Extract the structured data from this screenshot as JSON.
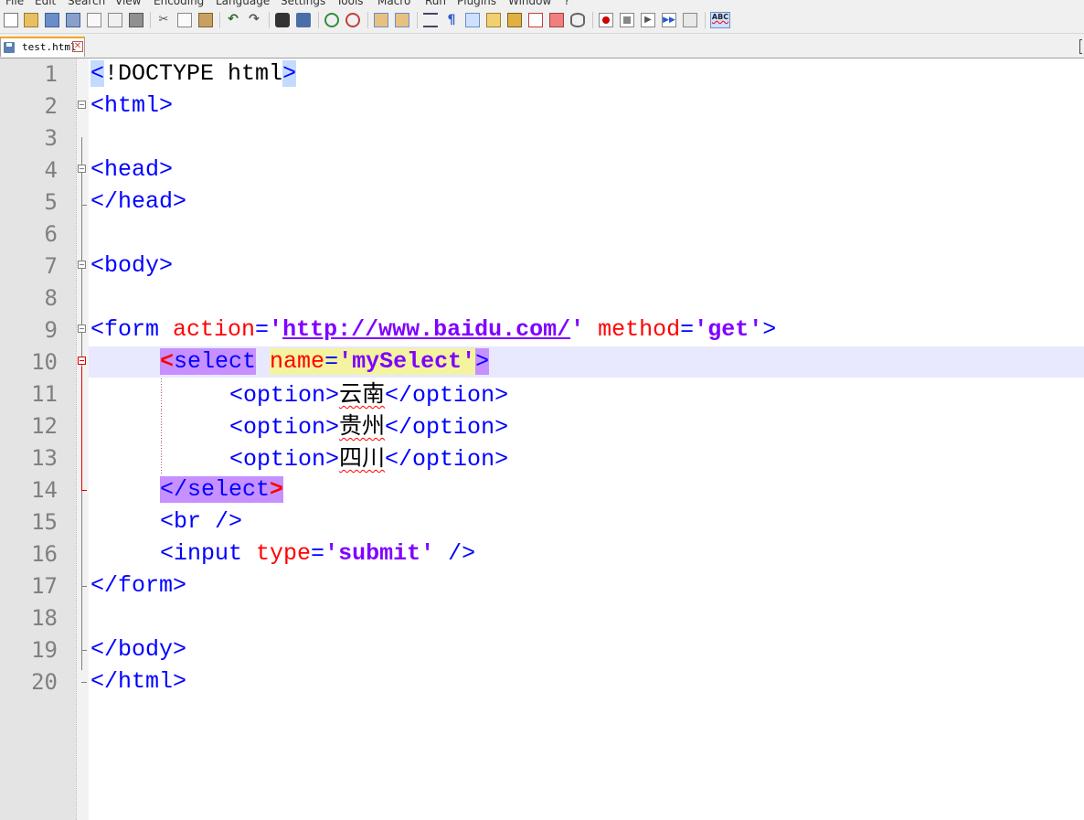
{
  "menu": [
    "File",
    "Edit",
    "Search",
    "View",
    "Encoding",
    "Language",
    "Settings",
    "Tools",
    "Macro",
    "Run",
    "Plugins",
    "Window",
    "?"
  ],
  "toolbar": {
    "icons": [
      "new-file-icon",
      "open-file-icon",
      "save-icon",
      "save-all-icon",
      "close-icon",
      "close-all-icon",
      "print-icon",
      "cut-icon",
      "copy-icon",
      "paste-icon",
      "undo-icon",
      "redo-icon",
      "find-icon",
      "replace-icon",
      "zoom-in-icon",
      "zoom-out-icon",
      "sync-vertical-icon",
      "sync-horizontal-icon",
      "word-wrap-icon",
      "show-all-characters-icon",
      "indent-guide-icon",
      "user-language-icon",
      "doc-map-icon",
      "function-list-icon",
      "folder-workspace-icon",
      "monitoring-icon",
      "record-macro-icon",
      "stop-recording-icon",
      "play-macro-icon",
      "run-macro-multiple-icon",
      "save-macro-icon",
      "spell-check-icon"
    ],
    "spellcheck_label": "ABC"
  },
  "tab": {
    "label": "test.html",
    "close_symbol": "✕"
  },
  "editor": {
    "current_line": 10,
    "lines": [
      {
        "n": "1"
      },
      {
        "n": "2"
      },
      {
        "n": "3"
      },
      {
        "n": "4"
      },
      {
        "n": "5"
      },
      {
        "n": "6"
      },
      {
        "n": "7"
      },
      {
        "n": "8"
      },
      {
        "n": "9"
      },
      {
        "n": "10"
      },
      {
        "n": "11"
      },
      {
        "n": "12"
      },
      {
        "n": "13"
      },
      {
        "n": "14"
      },
      {
        "n": "15"
      },
      {
        "n": "16"
      },
      {
        "n": "17"
      },
      {
        "n": "18"
      },
      {
        "n": "19"
      },
      {
        "n": "20"
      }
    ],
    "tokens": {
      "l1": [
        "<",
        "!DOCTYPE html",
        ">"
      ],
      "l2": "<html>",
      "l4": "<head>",
      "l5": "</head>",
      "l7": "<body>",
      "l9": [
        "<form ",
        "action",
        "=",
        "'",
        "http://www.baidu.com/",
        "'",
        " method",
        "=",
        "'get'",
        ">"
      ],
      "l10": [
        "<",
        "select",
        " ",
        "name",
        "=",
        "'mySelect'",
        ">"
      ],
      "l11": [
        "<option>",
        "云南",
        "</option>"
      ],
      "l12": [
        "<option>",
        "贵州",
        "</option>"
      ],
      "l13": [
        "<option>",
        "四川",
        "</option>"
      ],
      "l14": [
        "</select",
        ">"
      ],
      "l15": "<br />",
      "l16": [
        "<input ",
        "type",
        "=",
        "'submit'",
        " />"
      ],
      "l17": "</form>",
      "l19": "</body>",
      "l20": "</html>"
    }
  },
  "colors": {
    "tag": "#0000ff",
    "attribute": "#ff0000",
    "string": "#8000ff",
    "gutter": "#e4e4e4",
    "current_line": "#e8e8ff",
    "tab_accent": "#f5a623"
  }
}
